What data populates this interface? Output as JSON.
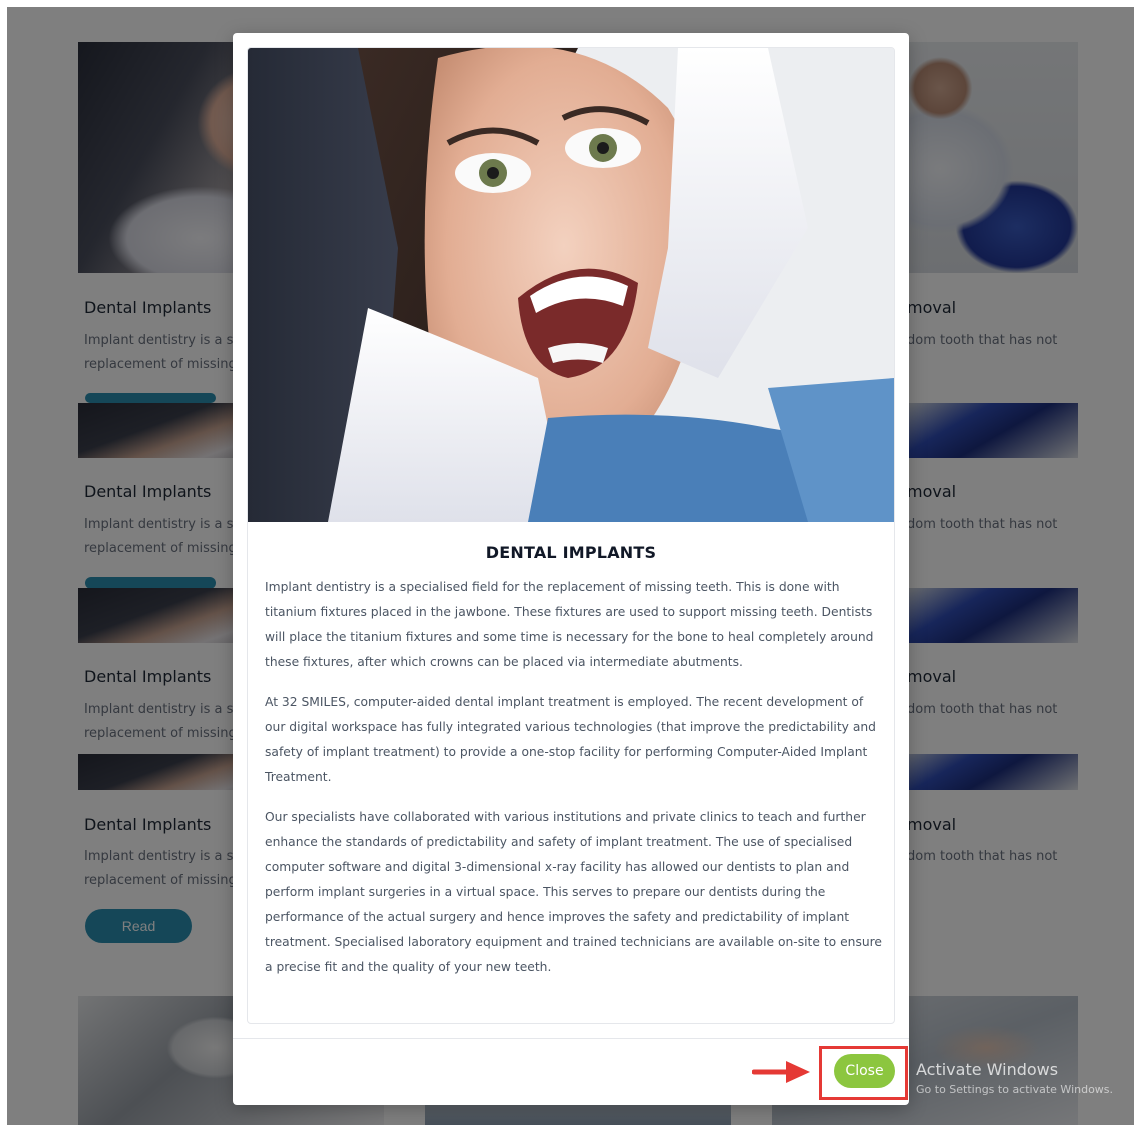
{
  "background_cards": {
    "left_title": "Dental Implants",
    "left_desc_line1": "Implant dentistry is a sp",
    "left_desc_line2": "replacement of missing",
    "right_title": "moval",
    "right_desc": "dom tooth that has not",
    "read_more_label": "Read more→"
  },
  "modal": {
    "title": "DENTAL IMPLANTS",
    "paragraphs": [
      "Implant dentistry is a specialised field for the replacement of missing teeth. This is done with titanium fixtures placed in the jawbone. These fixtures are used to support missing teeth. Dentists will place the titanium fixtures and some time is necessary for the bone to heal completely around these fixtures, after which crowns can be placed via intermediate abutments.",
      "At 32 SMILES, computer-aided dental implant treatment is employed. The recent development of our digital workspace has fully integrated various technologies (that improve the predictability and safety of implant treatment) to provide a one-stop facility for performing Computer-Aided Implant Treatment.",
      "Our specialists have collaborated with various institutions and private clinics to teach and further enhance the standards of predictability and safety of implant treatment. The use of specialised computer software and digital 3-dimensional x-ray facility has allowed our dentists to plan and perform implant surgeries in a virtual space. This serves to prepare our dentists during the performance of the actual surgery and hence improves the safety and predictability of implant treatment. Specialised laboratory equipment and trained technicians are available on-site to ensure a precise fit and the quality of your new teeth."
    ],
    "close_label": "Close"
  },
  "watermark": {
    "title": "Activate Windows",
    "subtitle": "Go to Settings to activate Windows."
  },
  "colors": {
    "close_button": "#8cc63f",
    "read_more_button": "#2b8fb0",
    "highlight": "#e53935"
  }
}
